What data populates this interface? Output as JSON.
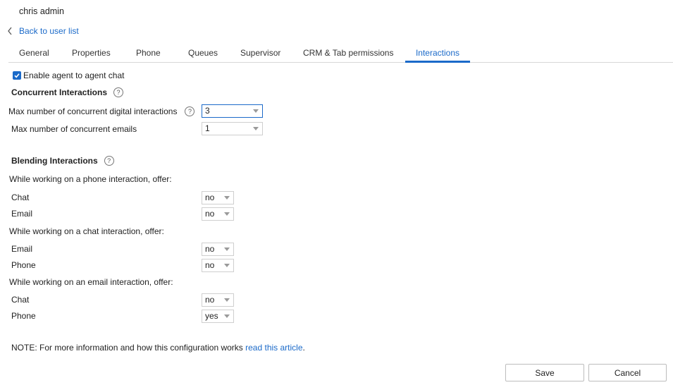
{
  "header": {
    "user_name": "chris admin"
  },
  "nav": {
    "back_label": "Back to user list"
  },
  "tabs": [
    {
      "label": "General"
    },
    {
      "label": "Properties"
    },
    {
      "label": "Phone"
    },
    {
      "label": "Queues"
    },
    {
      "label": "Supervisor"
    },
    {
      "label": "CRM & Tab permissions"
    },
    {
      "label": "Interactions",
      "active": true
    }
  ],
  "agent_chat": {
    "label": "Enable agent to agent chat",
    "checked": true
  },
  "concurrent": {
    "title": "Concurrent Interactions",
    "digital_label": "Max number of concurrent digital interactions",
    "digital_value": "3",
    "emails_label": "Max number of concurrent emails",
    "emails_value": "1"
  },
  "blending": {
    "title": "Blending Interactions",
    "phone_heading": "While working on a phone interaction, offer:",
    "phone_chat_label": "Chat",
    "phone_chat_value": "no",
    "phone_email_label": "Email",
    "phone_email_value": "no",
    "chat_heading": "While working on a chat interaction, offer:",
    "chat_email_label": "Email",
    "chat_email_value": "no",
    "chat_phone_label": "Phone",
    "chat_phone_value": "no",
    "email_heading": "While working on an email interaction, offer:",
    "email_chat_label": "Chat",
    "email_chat_value": "no",
    "email_phone_label": "Phone",
    "email_phone_value": "yes"
  },
  "note": {
    "text": "NOTE: For more information and how this configuration works ",
    "link": "read this article",
    "suffix": "."
  },
  "actions": {
    "save": "Save",
    "cancel": "Cancel"
  },
  "colors": {
    "accent": "#1b6ac9"
  }
}
